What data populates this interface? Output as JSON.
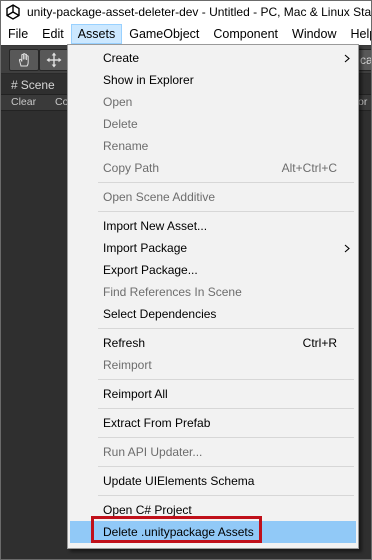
{
  "window": {
    "title": "unity-package-asset-deleter-dev - Untitled - PC, Mac & Linux Standalone"
  },
  "menubar": {
    "items": [
      "File",
      "Edit",
      "Assets",
      "GameObject",
      "Component",
      "Window",
      "Help"
    ],
    "active": "Assets"
  },
  "scene_tab": {
    "label": "Scene"
  },
  "scene_toolbar": {
    "clear": "Clear",
    "collapse": "Co",
    "right_fragment": "or"
  },
  "right_edge_fragment": "cal",
  "assets_menu": {
    "create": "Create",
    "show_in_explorer": "Show in Explorer",
    "open": "Open",
    "delete": "Delete",
    "rename": "Rename",
    "copy_path": "Copy Path",
    "copy_path_shortcut": "Alt+Ctrl+C",
    "open_scene_additive": "Open Scene Additive",
    "import_new_asset": "Import New Asset...",
    "import_package": "Import Package",
    "export_package": "Export Package...",
    "find_references": "Find References In Scene",
    "select_dependencies": "Select Dependencies",
    "refresh": "Refresh",
    "refresh_shortcut": "Ctrl+R",
    "reimport": "Reimport",
    "reimport_all": "Reimport All",
    "extract_from_prefab": "Extract From Prefab",
    "run_api_updater": "Run API Updater...",
    "update_uielements_schema": "Update UIElements Schema",
    "open_csharp_project": "Open C# Project",
    "delete_unitypackage_assets": "Delete .unitypackage Assets"
  },
  "colors": {
    "highlight": "#91c9f7",
    "callout_border": "#c0101a",
    "menubar_active": "#cce8ff"
  }
}
